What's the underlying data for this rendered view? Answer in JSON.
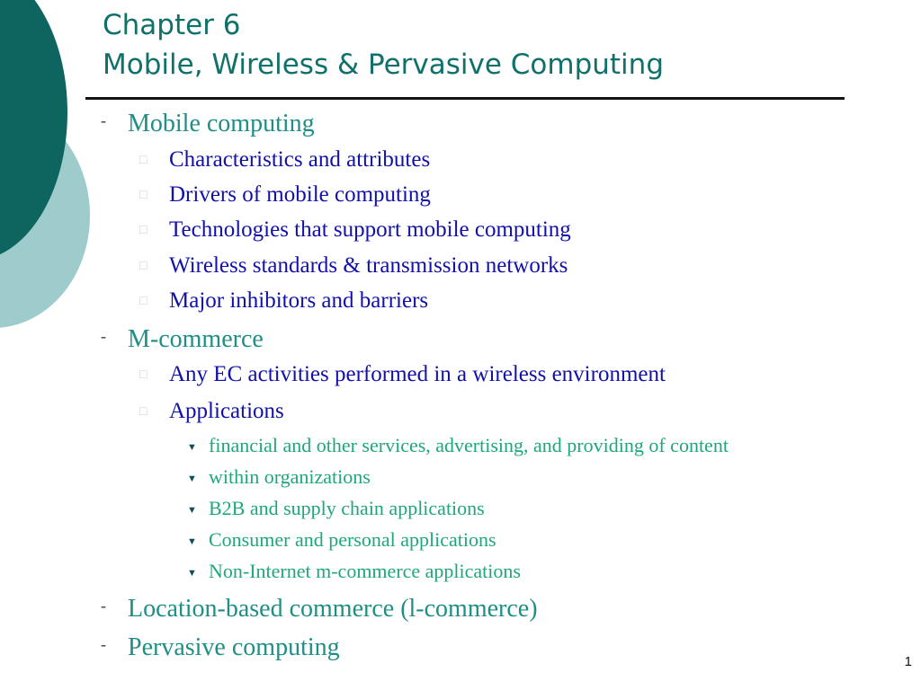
{
  "slide": {
    "title_line1": "Chapter 6",
    "title_line2": "Mobile, Wireless & Pervasive Computing",
    "page_number": "1",
    "colors": {
      "title": "#10706a",
      "level1": "#1e8f86",
      "level2": "#1111aa",
      "level3": "#1ea878",
      "dark_circle": "#0e6560",
      "light_circle": "#9ecbcc"
    },
    "bullets": {
      "level1_marker": "-",
      "level2_marker": "□",
      "level3_marker": "▼"
    },
    "items": [
      {
        "level": 1,
        "text": "Mobile computing"
      },
      {
        "level": 2,
        "text": "Characteristics and attributes"
      },
      {
        "level": 2,
        "text": "Drivers of mobile computing"
      },
      {
        "level": 2,
        "text": "Technologies that support mobile computing"
      },
      {
        "level": 2,
        "text": "Wireless standards & transmission networks"
      },
      {
        "level": 2,
        "text": "Major inhibitors and barriers"
      },
      {
        "level": 1,
        "text": "M-commerce"
      },
      {
        "level": 2,
        "text": "Any EC activities performed in a wireless environment"
      },
      {
        "level": 2,
        "text": "Applications"
      },
      {
        "level": 3,
        "text": "financial and other services, advertising, and providing of content"
      },
      {
        "level": 3,
        "text": "within organizations"
      },
      {
        "level": 3,
        "text": "B2B and supply chain applications"
      },
      {
        "level": 3,
        "text": "Consumer and personal applications"
      },
      {
        "level": 3,
        "text": "Non-Internet m-commerce applications"
      },
      {
        "level": 1,
        "text": "Location-based commerce (l-commerce)"
      },
      {
        "level": 1,
        "text": "Pervasive computing"
      }
    ]
  }
}
